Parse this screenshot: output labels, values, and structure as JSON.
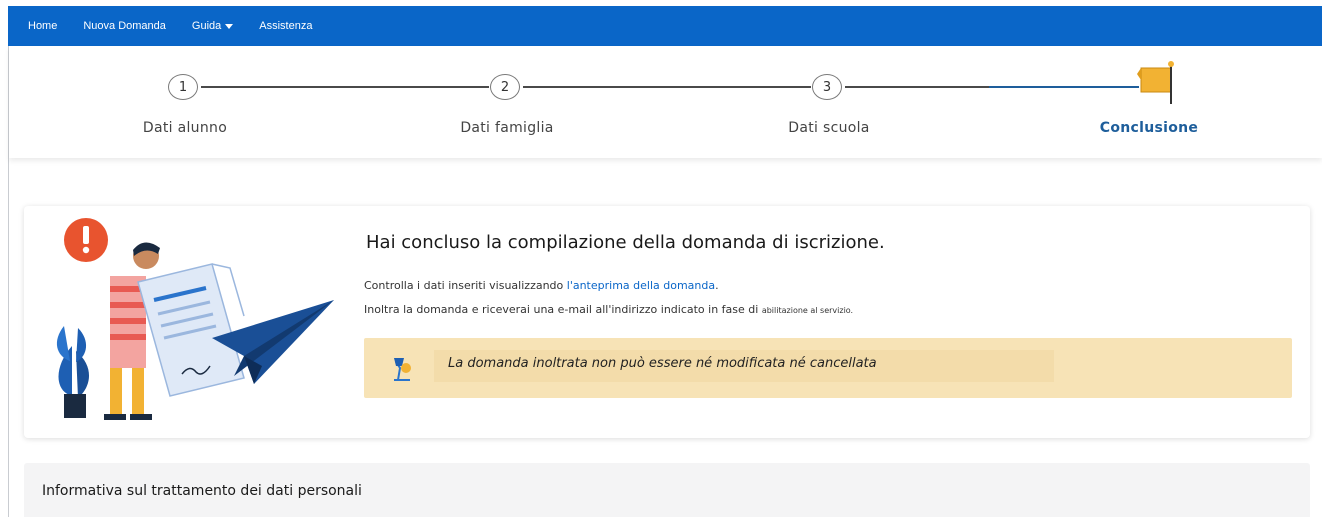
{
  "navbar": {
    "items": [
      "Home",
      "Nuova Domanda",
      "Guida",
      "Assistenza"
    ],
    "bg_color": "#0a66c8"
  },
  "stepper": {
    "steps": [
      {
        "number": "1",
        "label": "Dati alunno"
      },
      {
        "number": "2",
        "label": "Dati famiglia"
      },
      {
        "number": "3",
        "label": "Dati scuola"
      },
      {
        "number": "",
        "label": "Conclusione",
        "icon": "flag-icon",
        "active": true
      }
    ],
    "active_color": "#1e5e9b"
  },
  "conclusion": {
    "title": "Hai concluso la compilazione della domanda di iscrizione.",
    "line1_prefix": "Controlla i dati inseriti visualizzando ",
    "line1_link": "l'anteprima della domanda",
    "line1_suffix": ".",
    "line2": "Inoltra la domanda e riceverai una e-mail all'indirizzo indicato in fase di ",
    "line2_small": "abilitazione al servizio.",
    "warning": "La domanda inoltrata non può essere né modificata né cancellata",
    "warning_color": "#f7e3b6"
  },
  "info_panel": {
    "title": "Informativa sul trattamento dei dati personali"
  }
}
